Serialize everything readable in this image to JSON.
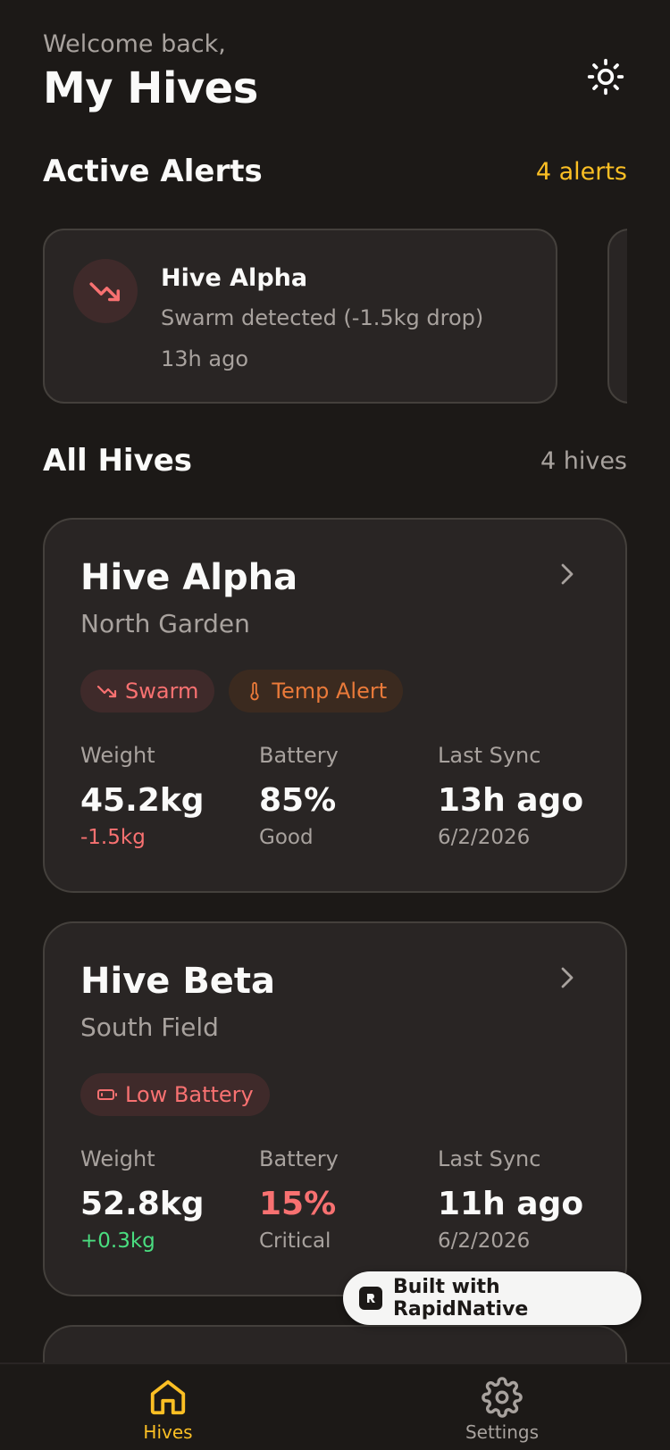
{
  "header": {
    "welcome": "Welcome back,",
    "title": "My Hives"
  },
  "alerts_section": {
    "title": "Active Alerts",
    "count": "4 alerts"
  },
  "alerts": [
    {
      "hive": "Hive Alpha",
      "message": "Swarm detected (-1.5kg drop)",
      "time": "13h ago",
      "icon": "trending-down-icon"
    }
  ],
  "hives_section": {
    "title": "All Hives",
    "count": "4 hives"
  },
  "hives": [
    {
      "name": "Hive Alpha",
      "location": "North Garden",
      "badges": [
        {
          "label": "Swarm",
          "icon": "trending-down-icon",
          "color": "#f87171"
        },
        {
          "label": "Temp Alert",
          "icon": "thermometer-icon",
          "color": "#ea7a3a"
        }
      ],
      "weight_label": "Weight",
      "weight": "45.2kg",
      "weight_change": "-1.5kg",
      "battery_label": "Battery",
      "battery": "85%",
      "battery_status": "Good",
      "sync_label": "Last Sync",
      "sync": "13h ago",
      "sync_date": "6/2/2026"
    },
    {
      "name": "Hive Beta",
      "location": "South Field",
      "badges": [
        {
          "label": "Low Battery",
          "icon": "battery-low-icon",
          "color": "#f87171"
        }
      ],
      "weight_label": "Weight",
      "weight": "52.8kg",
      "weight_change": "+0.3kg",
      "battery_label": "Battery",
      "battery": "15%",
      "battery_status": "Critical",
      "sync_label": "Last Sync",
      "sync": "11h ago",
      "sync_date": "6/2/2026"
    }
  ],
  "badge_rapid": "Built with RapidNative",
  "tabs": [
    {
      "label": "Hives",
      "icon": "home-icon",
      "active": true
    },
    {
      "label": "Settings",
      "icon": "gear-icon",
      "active": false
    }
  ],
  "colors": {
    "accent": "#fbbf24",
    "danger": "#f87171",
    "success": "#4ade80",
    "warning": "#ea7a3a"
  }
}
